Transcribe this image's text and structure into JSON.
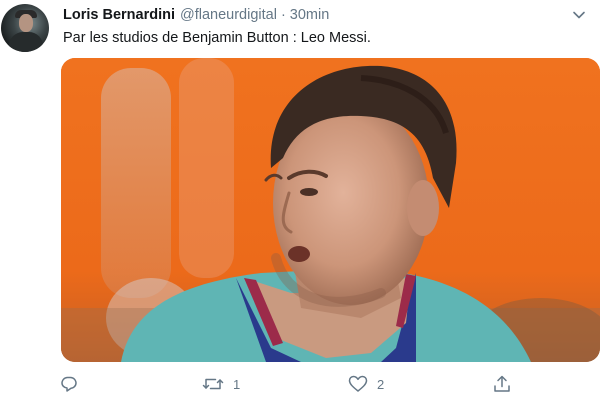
{
  "tweet": {
    "author_name": "Loris Bernardini",
    "handle": "@flaneurdigital",
    "separator": "·",
    "time": "30min",
    "text": "Par les studios de Benjamin Button : Leo Messi."
  },
  "actions": {
    "reply": {
      "icon": "reply-icon",
      "count": ""
    },
    "retweet": {
      "icon": "retweet-icon",
      "count": "1"
    },
    "like": {
      "icon": "heart-icon",
      "count": "2"
    },
    "share": {
      "icon": "share-icon"
    }
  },
  "colors": {
    "text_primary": "#14171a",
    "text_secondary": "#657786",
    "media_background": "#ef6a18",
    "jersey": "#5fb5b4",
    "collar": "#2a3a8c"
  }
}
